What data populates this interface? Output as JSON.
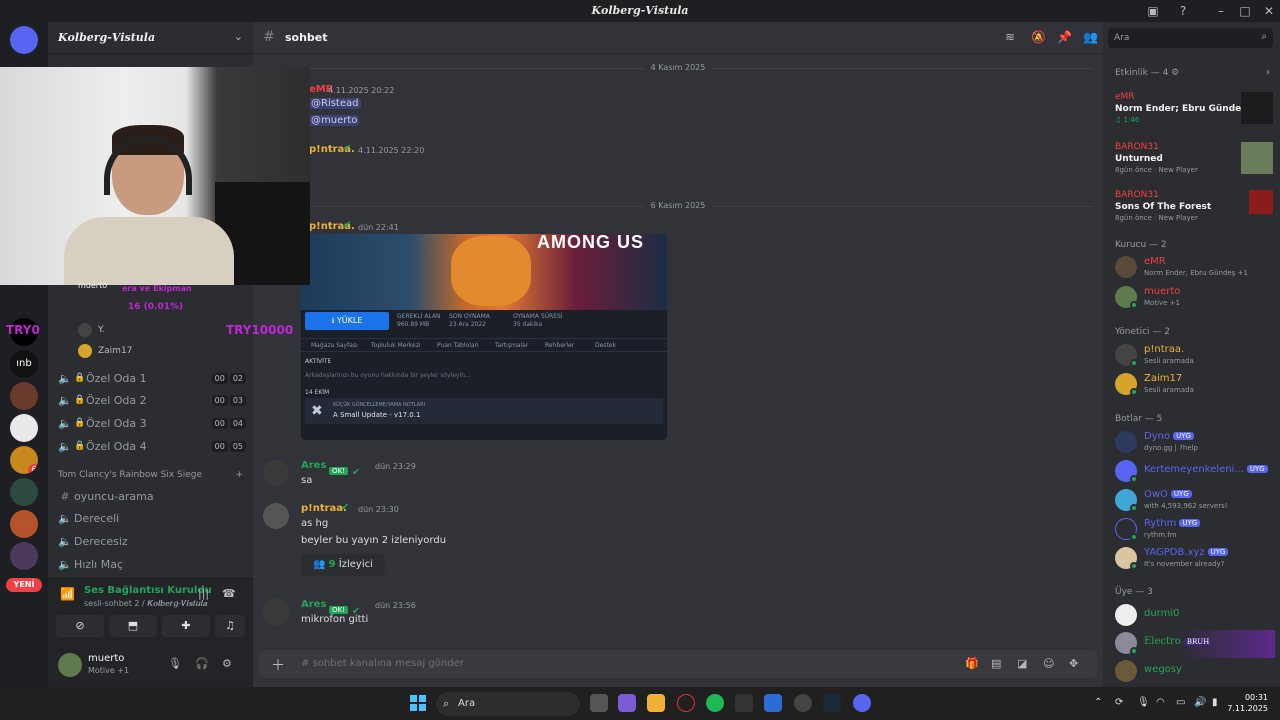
{
  "window": {
    "title": "𝑲𝒐𝒍𝒃𝒆𝒓𝒈-𝑽𝒊𝒔𝒕𝒖𝒍𝒂"
  },
  "server": {
    "name": "𝑲𝒐𝒍𝒃𝒆𝒓𝒈-𝑽𝒊𝒔𝒕𝒖𝒍𝒂",
    "new_label": "YENİ"
  },
  "webcam_overlay": {
    "name": "muerto",
    "text_top": "era ve Ekipman",
    "text_pct": "16 (0.01%)",
    "try_left": "TRY0",
    "try_right": "TRY10000"
  },
  "voice_members": [
    {
      "name": "Y."
    },
    {
      "name": "Zaim17"
    }
  ],
  "private_rooms": [
    {
      "label": "Özel Oda 1",
      "a": "00",
      "b": "02"
    },
    {
      "label": "Özel Oda 2",
      "a": "00",
      "b": "03"
    },
    {
      "label": "Özel Oda 3",
      "a": "00",
      "b": "04"
    },
    {
      "label": "Özel Oda 4",
      "a": "00",
      "b": "05"
    }
  ],
  "category": {
    "name": "Tom Clancy's Rainbow Six Siege"
  },
  "r6_channels": [
    {
      "label": "oyuncu-arama",
      "type": "text"
    },
    {
      "label": "Dereceli",
      "type": "voice"
    },
    {
      "label": "Derecesiz",
      "type": "voice"
    },
    {
      "label": "Hızlı Maç",
      "type": "voice"
    }
  ],
  "voice_panel": {
    "status": "Ses Bağlantısı Kuruldu",
    "sub": "sesli-sohbet 2 / 𝑲𝒐𝒍𝒃𝒆𝒓𝒈-𝑽𝒊𝒔𝒕𝒖𝒍𝒂"
  },
  "user_panel": {
    "name": "muerto",
    "status": "Motive +1"
  },
  "chat": {
    "channel": "sohbet",
    "dates": [
      "4 Kasım 2025",
      "6 Kasım 2025"
    ],
    "messages": [
      {
        "author": "eMR",
        "time": "4.11.2025 20:22",
        "lines": [
          "@Ristead",
          "@muerto"
        ]
      },
      {
        "author": "p!ntraa.",
        "time": "4.11.2025 22:20"
      },
      {
        "author": "p!ntraa.",
        "time": "dün 22:41"
      },
      {
        "author": "Ares",
        "tag": "OK!",
        "time": "dün 23:29",
        "text": "sa"
      },
      {
        "author": "p!ntraa.",
        "time": "dün 23:30",
        "text": "as hg",
        "text2": "beyler bu yayın 2 izleniyordu"
      },
      {
        "author": "Ares",
        "tag": "OK!",
        "time": "dün 23:56",
        "text": "mikrofon gitti"
      }
    ],
    "viewers": {
      "count": "9",
      "label": "İzleyici"
    },
    "composer_placeholder": "sohbet kanalına mesaj gönder"
  },
  "embed": {
    "title": "AMONG US",
    "install": "YÜKLE",
    "stats": [
      {
        "label": "GEREKLİ ALAN",
        "value": "960.89 MB"
      },
      {
        "label": "SON OYNAMA",
        "value": "23 Ara 2022"
      },
      {
        "label": "OYNAMA SÜRESİ",
        "value": "35 dakika"
      }
    ],
    "tabs": [
      "Mağaza Sayfası",
      "Topluluk Merkezi",
      "Puan Tabloları",
      "Tartışmalar",
      "Rehberler",
      "Destek"
    ],
    "activity": "AKTİVİTE",
    "activity_text": "Arkadaşlarınızı bu oyunu hakkında bir şeyler söyleyin...",
    "date": "14 EKİM",
    "update_label": "KÜÇÜK GÜNCELLEME/YAMA NOTLARI",
    "update_title": "A Small Update - v17.0.1"
  },
  "members_panel": {
    "search_placeholder": "Ara",
    "activity_header": "Etkinlik — 4",
    "activities": [
      {
        "user": "eMR",
        "title": "Norm Ender; Ebru Gündeş",
        "sub": "1:46"
      },
      {
        "user": "BARON31",
        "title": "Unturned",
        "sub": "8gün önce · New Player"
      },
      {
        "user": "BARON31",
        "title": "Sons Of The Forest",
        "sub": "8gün önce · New Player"
      }
    ],
    "groups": [
      {
        "title": "Kurucu — 2",
        "members": [
          {
            "name": "eMR",
            "status": "Norm Ender, Ebru Gündeş +1",
            "color": "#f23f43"
          },
          {
            "name": "muerto",
            "status": "Motive +1",
            "color": "#f23f43"
          }
        ]
      },
      {
        "title": "Yönetici — 2",
        "members": [
          {
            "name": "p!ntraa.",
            "status": "Sesli aramada",
            "color": "#f0b232"
          },
          {
            "name": "Zaim17",
            "status": "Sesli aramada",
            "color": "#f0b232"
          }
        ]
      },
      {
        "title": "Botlar — 5",
        "members": [
          {
            "name": "Dyno",
            "status": "dyno.gg | ?help",
            "color": "#5865f2",
            "tag": "UYG"
          },
          {
            "name": "Kertemeyenkeleni...",
            "status": "",
            "color": "#5865f2",
            "tag": "UYG"
          },
          {
            "name": "OwO",
            "status": "with 4,593,962 servers!",
            "color": "#5865f2",
            "tag": "UYG"
          },
          {
            "name": "Rythm",
            "status": "rythm.fm",
            "color": "#5865f2",
            "tag": "UYG"
          },
          {
            "name": "YAGPDB.xyz",
            "status": "It's november already?",
            "color": "#5865f2",
            "tag": "UYG"
          }
        ]
      },
      {
        "title": "Üye — 3",
        "members": [
          {
            "name": "durmi0",
            "status": "",
            "color": "#23a559"
          },
          {
            "name": "Electro",
            "status": "",
            "color": "#23a559",
            "tag": "BRUH"
          },
          {
            "name": "wegosy",
            "status": "",
            "color": "#23a559"
          }
        ]
      }
    ]
  },
  "taskbar": {
    "search": "Ara",
    "time": "00:31",
    "date": "7.11.2025"
  },
  "colors": {
    "accent": "#5865f2",
    "online": "#23a559",
    "danger": "#f23f43",
    "admin": "#f0b232"
  }
}
